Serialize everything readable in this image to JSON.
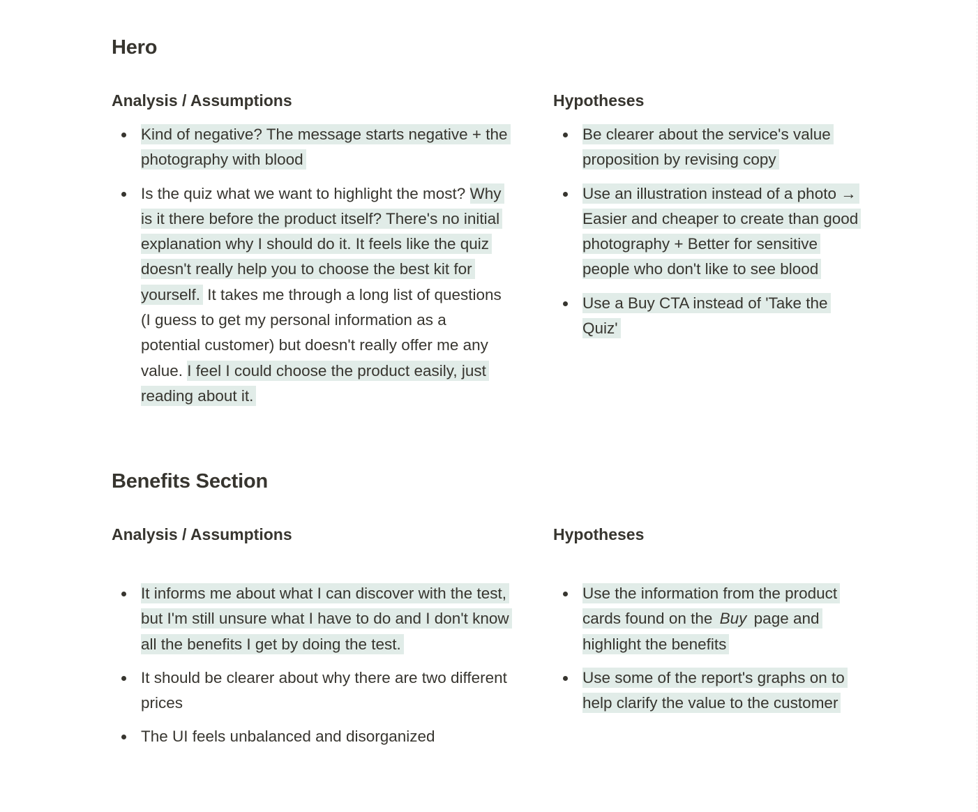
{
  "sections": [
    {
      "title": "Hero",
      "analysis": {
        "title": "Analysis / Assumptions",
        "items": [
          {
            "segments": [
              {
                "text": "Kind of negative? The message starts negative + the photography with blood",
                "highlight": true
              }
            ]
          },
          {
            "segments": [
              {
                "text": "Is the quiz what we want to highlight the most? ",
                "highlight": false
              },
              {
                "text": "Why is it there before the product itself? There's no initial explanation why I should do it. It feels like the quiz doesn't really help you to choose the best kit for yourself.",
                "highlight": true
              },
              {
                "text": " It takes me through a long list of questions (I guess to get my personal information as a potential customer) but doesn't really offer me any value. ",
                "highlight": false
              },
              {
                "text": "I feel I could choose the product easily, just reading about it.",
                "highlight": true
              }
            ]
          }
        ]
      },
      "hypotheses": {
        "title": "Hypotheses",
        "items": [
          {
            "segments": [
              {
                "text": "Be clearer about the service's value proposition by revising copy",
                "highlight": true
              }
            ]
          },
          {
            "segments": [
              {
                "text": "Use an illustration instead of a photo → Easier and cheaper to create than good photography + Better for sensitive people who don't like to see blood",
                "highlight": true
              }
            ]
          },
          {
            "segments": [
              {
                "text": "Use a Buy CTA instead of 'Take the Quiz'",
                "highlight": true
              }
            ]
          }
        ]
      }
    },
    {
      "title": "Benefits Section",
      "analysis": {
        "title": "Analysis / Assumptions",
        "items": [
          {
            "segments": [
              {
                "text": "It informs me about what I can discover with the test, but I'm still unsure what I have to do and I don't know all the benefits I get by doing the test.",
                "highlight": true
              }
            ]
          },
          {
            "segments": [
              {
                "text": "It should be clearer about why there are two different prices",
                "highlight": false
              }
            ]
          },
          {
            "segments": [
              {
                "text": "The UI feels unbalanced and disorganized",
                "highlight": false
              }
            ]
          }
        ]
      },
      "hypotheses": {
        "title": "Hypotheses",
        "items": [
          {
            "segments": [
              {
                "text": "Use the information from the product cards found on the ",
                "highlight": true
              },
              {
                "text": "Buy",
                "highlight": true,
                "italic": true
              },
              {
                "text": " page and highlight the benefits",
                "highlight": true
              }
            ]
          },
          {
            "segments": [
              {
                "text": "Use some of the report's graphs on to help clarify the value to the customer",
                "highlight": true
              }
            ]
          }
        ]
      }
    }
  ],
  "colors": {
    "highlight": "#e1ece8",
    "text": "#37352f"
  }
}
